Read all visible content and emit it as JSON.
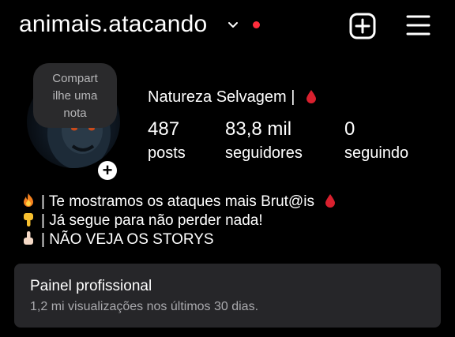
{
  "header": {
    "username": "animais.atacando",
    "icons": {
      "switch_account": "chevron-down-icon",
      "notification": "red-dot-icon",
      "create": "plus-square-icon",
      "menu": "hamburger-menu-icon"
    },
    "accent_dot_color": "#ff2d3c"
  },
  "profile": {
    "note_bubble": [
      "Compart",
      "ilhe uma",
      "nota"
    ],
    "avatar_add_icon": "+",
    "display_name": "Natureza Selvagem |",
    "stats": [
      {
        "value": "487",
        "label": "posts"
      },
      {
        "value": "83,8 mil",
        "label": "seguidores"
      },
      {
        "value": "0",
        "label": "seguindo"
      }
    ]
  },
  "bio": {
    "lines": [
      {
        "emoji": "fire-emoji",
        "text": "| Te mostramos os ataques mais Brut@is"
      },
      {
        "emoji": "pointing-down-emoji",
        "text": "| Já segue para não perder nada!"
      },
      {
        "emoji": "pointing-up-emoji",
        "text": "| NÃO VEJA OS STORYS"
      }
    ],
    "trailing_emoji": "blood-drop-emoji"
  },
  "professional_panel": {
    "title": "Painel profissional",
    "subtitle": "1,2 mi visualizações nos últimos 30 dias."
  }
}
